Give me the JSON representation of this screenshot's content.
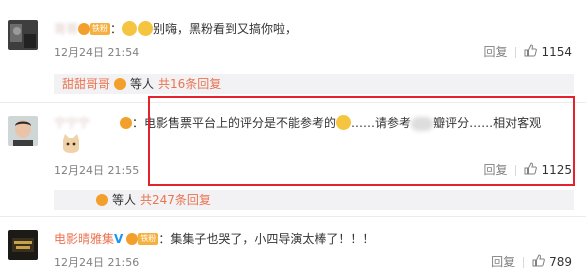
{
  "comments": [
    {
      "username": "哥哥",
      "badge_label": "铁粉",
      "text": "别嗨，黑粉看到又搞你啦，",
      "timestamp": "12月24日 21:54",
      "reply_label": "回复",
      "like_count": "1154",
      "sub": {
        "user": "甜甜哥哥",
        "mid": "等人",
        "link": "共16条回复"
      }
    },
    {
      "username": "宁宁宁",
      "text_a": "电影售票平台上的评分是不能参考的",
      "text_b": "……请参考",
      "text_c": "瓣评分……相对客观",
      "timestamp": "12月24日 21:55",
      "reply_label": "回复",
      "like_count": "1125",
      "sub": {
        "user": "",
        "mid": "等人",
        "link": "共247条回复"
      }
    },
    {
      "username": "电影晴雅集",
      "badge_label": "铁粉",
      "text": "集集子也哭了，小四导演太棒了！！！",
      "timestamp": "12月24日 21:56",
      "reply_label": "回复",
      "like_count": "789"
    }
  ],
  "icons": {
    "like": "thumbs-up-icon",
    "crown": "crown-icon",
    "verified": "verified-v-icon",
    "emoji_grin": "grinning-face-icon",
    "emoji_think": "thinking-face-icon"
  },
  "colors": {
    "username": "#eb7350",
    "highlight": "#e3222d",
    "meta": "#808080",
    "subbar": "#f2f2f5"
  }
}
